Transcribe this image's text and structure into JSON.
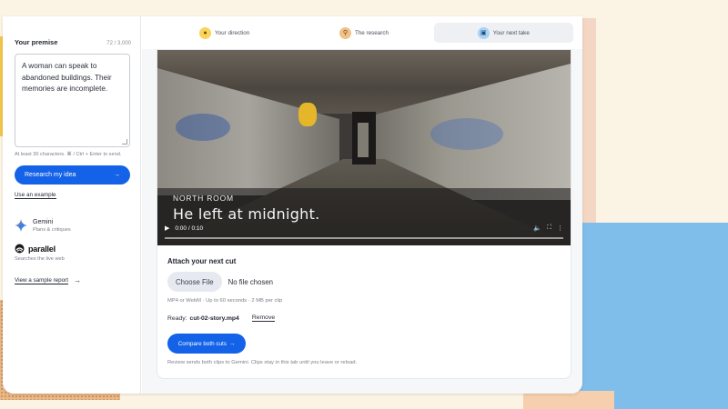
{
  "sidebar": {
    "premise_title": "Your premise",
    "premise_count": "72 / 3,000",
    "premise_text": "A woman can speak to abandoned buildings. Their memories are incomplete.",
    "hint": "At least 30 characters. ⌘ / Ctrl + Enter to send.",
    "research_button": "Research my idea",
    "research_arrow": "→",
    "example_link": "Use an example",
    "gemini_name": "Gemini",
    "gemini_sub": "Plans & critiques",
    "parallel_name": "parallel",
    "parallel_sub": "Searches the live web",
    "report_link": "View a sample report",
    "report_arrow": "→"
  },
  "tabs": [
    {
      "label": "Your direction",
      "icon": "bulb-icon"
    },
    {
      "label": "The research",
      "icon": "search-icon"
    },
    {
      "label": "Your next take",
      "icon": "video-icon"
    }
  ],
  "video": {
    "room_label": "NORTH ROOM",
    "caption": "He left at midnight.",
    "time": "0:00 / 0:10"
  },
  "attach": {
    "title": "Attach your next cut",
    "choose_file": "Choose File",
    "no_file": "No file chosen",
    "hint": "MP4 or WebM · Up to 60 seconds · 2 MB per clip",
    "ready_label": "Ready:",
    "ready_file": "cut-02-story.mp4",
    "remove": "Remove",
    "compare_button": "Compare both cuts",
    "compare_arrow": "→",
    "review_note": "Review sends both clips to Gemini. Clips stay in this tab until you leave or reload."
  },
  "colors": {
    "accent": "#1362e8",
    "background": "#fbf3e4"
  }
}
